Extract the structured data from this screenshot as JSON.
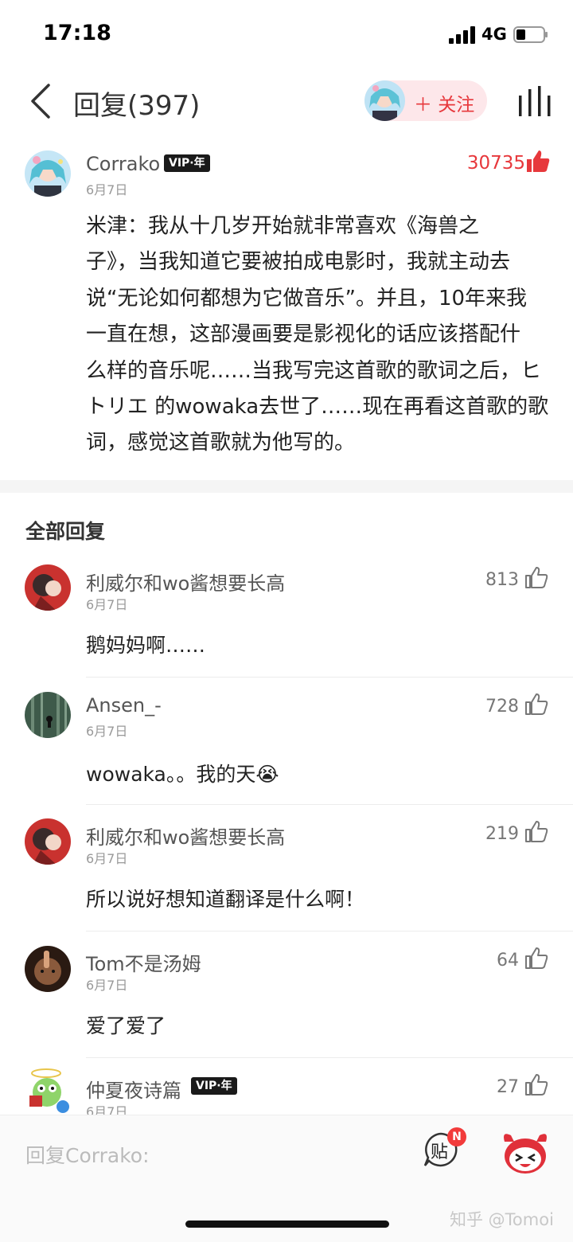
{
  "status_bar": {
    "time": "17:18",
    "network": "4G"
  },
  "header": {
    "title": "回复(397)",
    "follow_label": "＋ 关注"
  },
  "main_comment": {
    "author": "Corrako",
    "vip_badge": "VIP·年",
    "date": "6月7日",
    "likes": "30735",
    "lines": [
      "米津：我从十几岁开始就非常喜欢《海兽之",
      "子》，当我知道它要被拍成电影时，我就主动去",
      "说“无论如何都想为它做音乐”。并且，10年来我",
      "一直在想，这部漫画要是影视化的话应该搭配什",
      "么样的音乐呢……当我写完这首歌的歌词之后，ヒ",
      "トリエ 的wowaka去世了……现在再看这首歌的歌",
      "词，感觉这首歌就为他写的。"
    ]
  },
  "section_title": "全部回复",
  "replies": [
    {
      "author": "利威尔和wo酱想要长高",
      "date": "6月7日",
      "likes": "813",
      "text": "鹅妈妈啊……"
    },
    {
      "author": "Ansen_-",
      "date": "6月7日",
      "likes": "728",
      "text": "wowaka。。我的天😭"
    },
    {
      "author": "利威尔和wo酱想要长高",
      "date": "6月7日",
      "likes": "219",
      "text": "所以说好想知道翻译是什么啊！"
    },
    {
      "author": "Tom不是汤姆",
      "date": "6月7日",
      "likes": "64",
      "text": "爱了爱了"
    },
    {
      "author": "仲夏夜诗篇",
      "vip_badge": "VIP·年",
      "date": "6月7日",
      "likes": "27",
      "text": ""
    }
  ],
  "bottom_bar": {
    "reply_placeholder": "回复Corrako:",
    "sticker_label": "贴",
    "sticker_badge": "N"
  },
  "watermark": "知乎 @Tomoi",
  "colors": {
    "accent": "#e7383c",
    "follow_bg": "#fde7ea"
  }
}
